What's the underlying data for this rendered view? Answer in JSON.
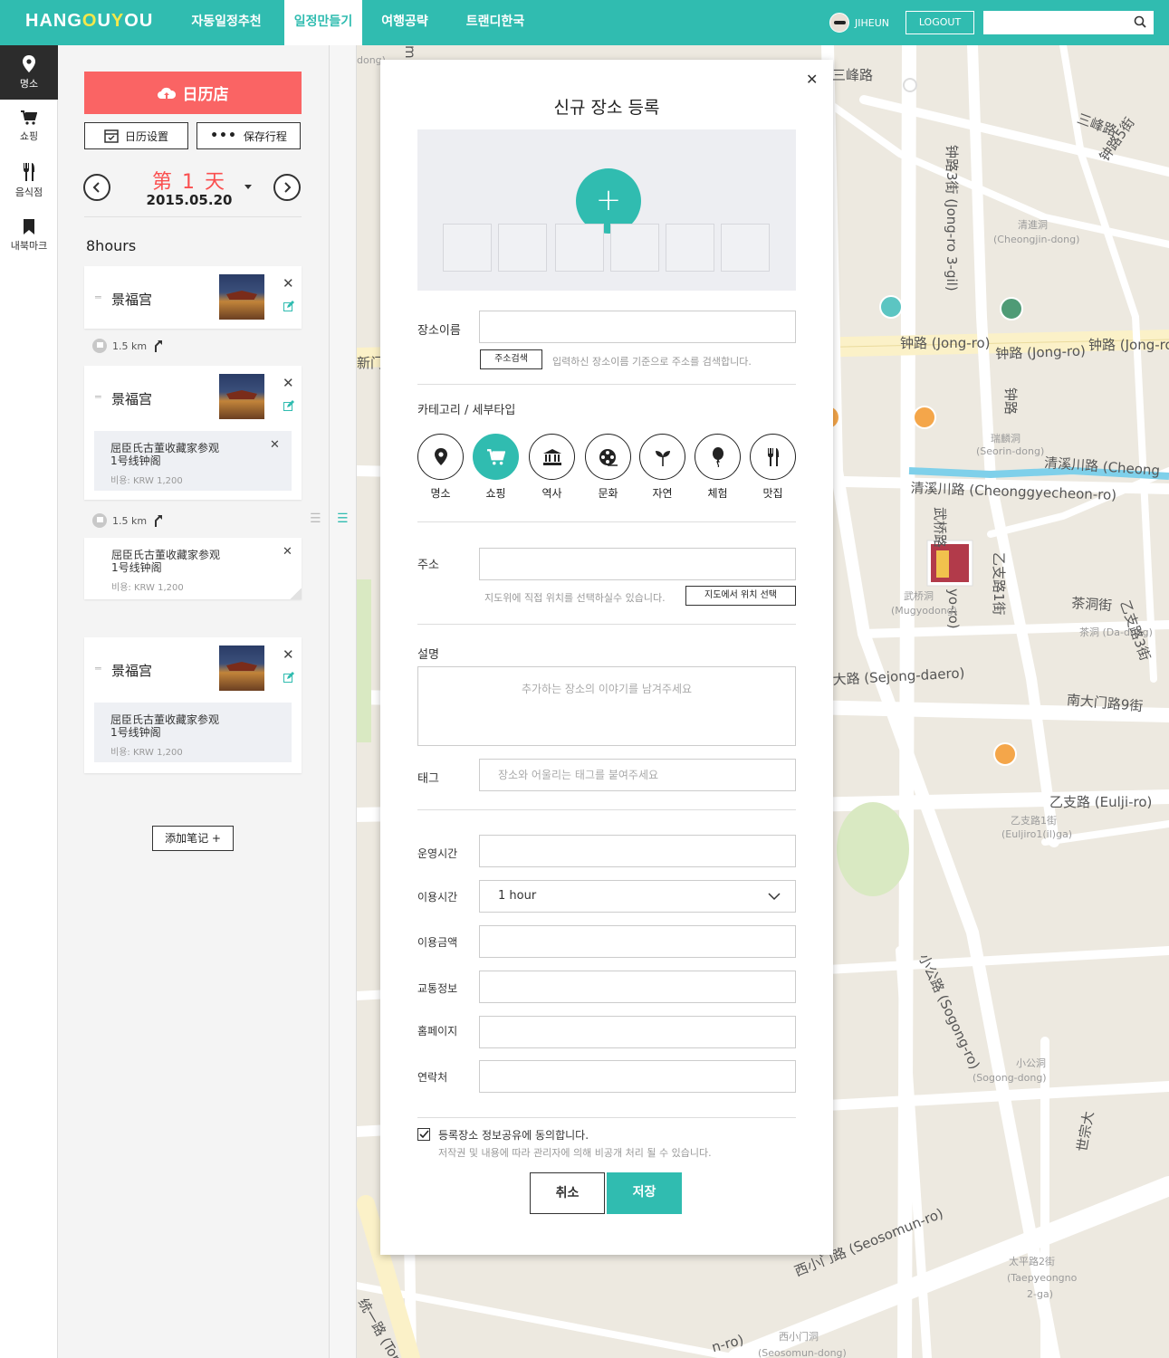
{
  "header": {
    "logo": {
      "part1": "HANG",
      "o1": "O",
      "part2": "U",
      "y": "Y",
      "o2": "O",
      "part3": "U"
    },
    "nav": [
      "자동일정추천",
      "일정만들기",
      "여행공략",
      "트랜디한국"
    ],
    "active_nav": "일정만들기",
    "username": "JIHEUN",
    "logout_label": "LOGOUT",
    "search_placeholder": ""
  },
  "icon_bar": [
    {
      "label": "명소",
      "icon": "map-pin-icon",
      "active": true
    },
    {
      "label": "쇼핑",
      "icon": "cart-icon",
      "active": false
    },
    {
      "label": "음식점",
      "icon": "fork-knife-icon",
      "active": false
    },
    {
      "label": "내북마크",
      "icon": "bookmark-icon",
      "active": false
    }
  ],
  "itinerary": {
    "calendar_button": "日历店",
    "settings_button": "日历设置",
    "save_button": "保存行程",
    "day_title": "第 1 天",
    "day_date": "2015.05.20",
    "hours": "8hours",
    "items": [
      {
        "name": "景福宫"
      },
      {
        "distance": "1.5 km"
      },
      {
        "name": "景福宫",
        "memo": {
          "title": "屈臣氏古董收藏家参观\n1号线钟阁",
          "cost": "비용: KRW 1,200"
        }
      },
      {
        "distance": "1.5 km"
      },
      {
        "memo_only": {
          "title": "屈臣氏古董收藏家参观\n1号线钟阁",
          "cost": "비용: KRW 1,200"
        }
      },
      {
        "name": "景福宫",
        "memo": {
          "title": "屈臣氏古董收藏家参观\n1号线钟阁",
          "cost": "비용: KRW 1,200"
        }
      }
    ],
    "add_note": "添加笔记 +"
  },
  "map": {
    "labels": [
      "三峰路",
      "三峰路",
      "钟路5街",
      "钟路3街 (Jong-ro 3-gil)",
      "清進洞",
      "(Cheongjin-dong)",
      "钟路 (Jong-ro)",
      "钟路 (Jong-ro)",
      "钟路 (Jong-ro",
      "钟路",
      "瑞麟洞",
      "(Seorin-dong)",
      "清溪川路 (Cheong",
      "清溪川路 (Cheonggyecheon-ro)",
      "武桥路",
      "yo-ro)",
      "武桥洞",
      "(Mugyodong)",
      "乙支路1街",
      "茶洞街",
      "茶洞 (Da-dong)",
      "乙支路3街",
      "大路 (Sejong-daero)",
      "南大门路9街",
      "乙支路 (Eulji-ro)",
      "乙支路1街",
      "(Euljiro1(il)ga)",
      "小公路 (Sogong-ro)",
      "小公洞",
      "(Sogong-dong)",
      "世宗大",
      "西小门路 (Seosomun-ro)",
      "西小门洞",
      "(Seosomun-dong)",
      "太平路2街",
      "(Taepyeongno",
      "2-ga)",
      "统一路 (Ton",
      "新门",
      "dong)",
      "m",
      "n-ro)"
    ]
  },
  "modal": {
    "title": "신규 장소 등록",
    "fields": {
      "name_label": "장소이름",
      "addr_search_btn": "주소검색",
      "addr_search_hint": "입력하신 장소이름 기준으로 주소를 검색합니다.",
      "category_label": "카테고리 / 세부타입",
      "address_label": "주소",
      "address_hint": "지도위에 직접 위치를 선택하실수 있습니다.",
      "map_select_btn": "지도에서 위치 선택",
      "desc_label": "설명",
      "desc_placeholder": "추가하는 장소의 이야기를 남겨주세요",
      "tag_label": "태그",
      "tag_placeholder": "장소와 어울리는 태그를 붙여주세요",
      "hours_label": "운영시간",
      "duration_label": "이용시간",
      "duration_value": "1 hour",
      "fee_label": "이용금액",
      "transport_label": "교통정보",
      "homepage_label": "홈페이지",
      "contact_label": "연락처"
    },
    "categories": [
      {
        "label": "명소",
        "icon": "map-pin-icon",
        "selected": false
      },
      {
        "label": "쇼핑",
        "icon": "cart-icon",
        "selected": true
      },
      {
        "label": "역사",
        "icon": "museum-icon",
        "selected": false
      },
      {
        "label": "문화",
        "icon": "film-reel-icon",
        "selected": false
      },
      {
        "label": "자연",
        "icon": "leaf-icon",
        "selected": false
      },
      {
        "label": "체험",
        "icon": "balloon-icon",
        "selected": false
      },
      {
        "label": "맛집",
        "icon": "fork-knife-icon",
        "selected": false
      }
    ],
    "consent": {
      "checked": true,
      "label": "등록장소 정보공유에 동의합니다.",
      "note": "저작권 및 내용에 따라 관리자에 의해 비공개 처리 될 수 있습니다."
    },
    "cancel_label": "취소",
    "save_label": "저장"
  },
  "colors": {
    "accent": "#30bcb0",
    "calendar_button": "#fa6464",
    "day_title": "#fa4f4f"
  }
}
